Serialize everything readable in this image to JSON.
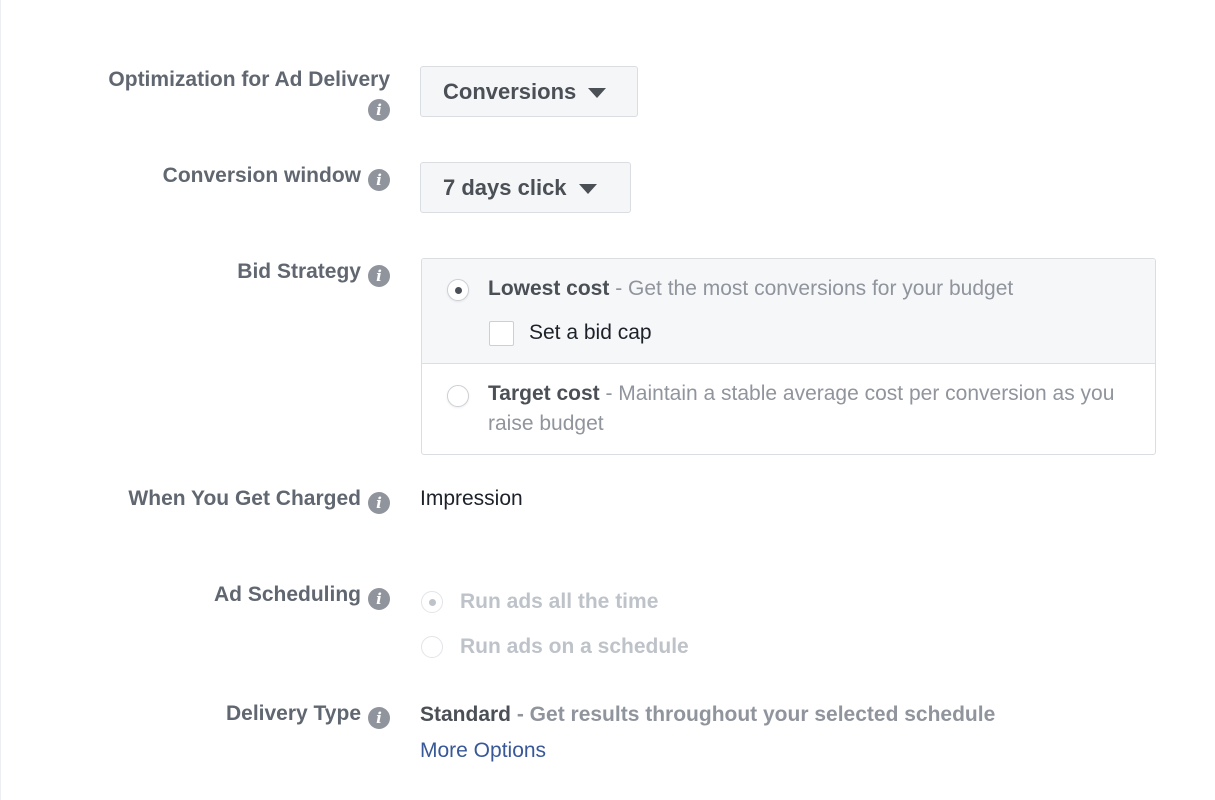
{
  "fields": {
    "optimization": {
      "label_line1": "Optimization for Ad Delivery",
      "value": "Conversions"
    },
    "conversion_window": {
      "label": "Conversion window",
      "value": "7 days click"
    },
    "bid_strategy": {
      "label": "Bid Strategy",
      "options": [
        {
          "title": "Lowest cost",
          "desc": " - Get the most conversions for your budget",
          "selected": true
        },
        {
          "title": "Target cost",
          "desc": " - Maintain a stable average cost per conversion as you raise budget",
          "selected": false
        }
      ],
      "bid_cap_label": "Set a bid cap",
      "bid_cap_checked": false
    },
    "charged": {
      "label": "When You Get Charged",
      "value": "Impression"
    },
    "ad_scheduling": {
      "label": "Ad Scheduling",
      "options": [
        {
          "label": "Run ads all the time",
          "selected": true,
          "disabled": true
        },
        {
          "label": "Run ads on a schedule",
          "selected": false,
          "disabled": true
        }
      ]
    },
    "delivery_type": {
      "label": "Delivery Type",
      "value_title": "Standard",
      "value_desc": " - Get results throughout your selected schedule",
      "more_options": "More Options"
    }
  },
  "icons": {
    "info_glyph": "i"
  },
  "colors": {
    "link": "#385898",
    "label": "#606770",
    "muted": "#90949c",
    "disabled": "#bec3c9"
  }
}
